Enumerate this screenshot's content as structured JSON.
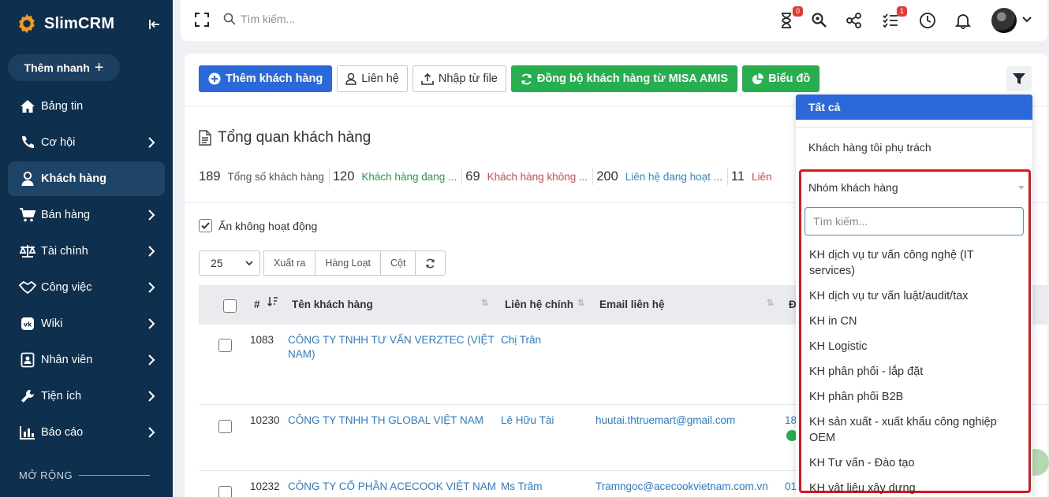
{
  "app": {
    "name": "SlimCRM"
  },
  "sidebar": {
    "quick_add": "Thêm nhanh",
    "items": [
      {
        "label": "Bảng tin",
        "icon": "home-icon",
        "chevron": false,
        "active": false
      },
      {
        "label": "Cơ hội",
        "icon": "handshake-icon",
        "chevron": true,
        "active": false
      },
      {
        "label": "Khách hàng",
        "icon": "user-icon",
        "chevron": false,
        "active": true
      },
      {
        "label": "Bán hàng",
        "icon": "cart-icon",
        "chevron": true,
        "active": false
      },
      {
        "label": "Tài chính",
        "icon": "scale-icon",
        "chevron": true,
        "active": false
      },
      {
        "label": "Công việc",
        "icon": "task-handshake-icon",
        "chevron": true,
        "active": false
      },
      {
        "label": "Wiki",
        "icon": "vk-icon",
        "chevron": true,
        "active": false
      },
      {
        "label": "Nhân viên",
        "icon": "id-card-icon",
        "chevron": true,
        "active": false
      },
      {
        "label": "Tiện ích",
        "icon": "wrench-icon",
        "chevron": true,
        "active": false
      },
      {
        "label": "Báo cáo",
        "icon": "bar-chart-icon",
        "chevron": true,
        "active": false
      }
    ],
    "section_label": "MỞ RỘNG"
  },
  "topbar": {
    "search_placeholder": "Tìm kiếm...",
    "hourglass_badge": "0",
    "tasks_badge": "1"
  },
  "toolbar": {
    "add_customer": "Thêm khách hàng",
    "contact": "Liên hệ",
    "import": "Nhập từ file",
    "sync": "Đồng bộ khách hàng từ MISA AMIS",
    "chart": "Biểu đồ"
  },
  "overview": {
    "title": "Tổng quan khách hàng",
    "stats": [
      {
        "num": "189",
        "label": "Tổng số khách hàng",
        "color": "c-gray"
      },
      {
        "num": "120",
        "label": "Khách hàng đang ...",
        "color": "c-green"
      },
      {
        "num": "69",
        "label": "Khách hàng không ...",
        "color": "c-red"
      },
      {
        "num": "200",
        "label": "Liên hệ đang hoạt ...",
        "color": "c-blue"
      },
      {
        "num": "11",
        "label": "Liên",
        "color": "c-red"
      }
    ]
  },
  "filters": {
    "hide_inactive": "Ẩn không hoạt động"
  },
  "table_tools": {
    "page_size": "25",
    "export": "Xuất ra",
    "bulk": "Hàng Loạt",
    "columns": "Cột"
  },
  "table": {
    "headers": {
      "id": "#",
      "name": "Tên khách hàng",
      "contact": "Liên hệ chính",
      "email": "Email liên hệ",
      "next": "Đ"
    },
    "rows": [
      {
        "id": "1083",
        "name_line1": "CÔNG TY TNHH TƯ VẤN VERZTEC (VIỆT",
        "name_line2": "NAM)",
        "contact": "Chị Trân",
        "email": "",
        "extra": ""
      },
      {
        "id": "10230",
        "name_line1": "CÔNG TY TNHH TH GLOBAL VIỆT NAM",
        "name_line2": "",
        "contact": "Lê Hữu Tài",
        "email": "huutai.thtruemart@gmail.com",
        "extra": "18"
      },
      {
        "id": "10232",
        "name_line1": "CÔNG TY CỔ PHẦN ACECOOK VIỆT NAM",
        "name_line2": "",
        "contact": "Ms Trâm",
        "email": "Tramngoc@acecookvietnam.com.vn",
        "extra": "01"
      }
    ]
  },
  "dropdown": {
    "all": "Tất cả",
    "mine": "Khách hàng tôi phụ trách",
    "group_label": "Nhóm khách hàng",
    "search_placeholder": "Tìm kiếm...",
    "options": [
      "KH dịch vụ tư vấn công nghệ (IT services)",
      "KH dịch vụ tư vấn luật/audit/tax",
      "KH in CN",
      "KH Logistic",
      "KH phân phối - lắp đặt",
      "KH phân phối B2B",
      "KH sản xuất - xuất khẩu công nghiệp OEM",
      "KH Tư vấn - Đào tạo",
      "KH vật liệu xây dựng"
    ]
  },
  "colors": {
    "sidebar_bg": "#0f2f4f",
    "primary": "#2b68d9",
    "green": "#27ae4e",
    "highlight": "#e0141e"
  }
}
